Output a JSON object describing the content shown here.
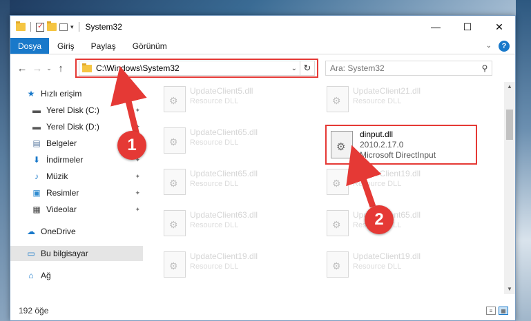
{
  "window": {
    "title": "System32",
    "minimize_glyph": "—",
    "maximize_glyph": "☐",
    "close_glyph": "✕"
  },
  "qat": {
    "dropdown_glyph": "▾"
  },
  "ribbon": {
    "tabs": [
      "Dosya",
      "Giriş",
      "Paylaş",
      "Görünüm"
    ],
    "expand_glyph": "⌄",
    "help_glyph": "?"
  },
  "nav": {
    "back_glyph": "←",
    "forward_glyph": "→",
    "recent_glyph": "⌄",
    "up_glyph": "↑",
    "address": "C:\\Windows\\System32",
    "address_dropdown_glyph": "⌄",
    "refresh_glyph": "↻",
    "search_placeholder": "Ara: System32",
    "search_glyph": "⚲"
  },
  "sidebar": {
    "items": [
      {
        "label": "Hızlı erişim",
        "icon": "star-icon",
        "glyph": "★",
        "color": "#1979ca",
        "pinned": false
      },
      {
        "label": "Yerel Disk (C:)",
        "icon": "drive-icon",
        "glyph": "▬",
        "color": "#555",
        "pinned": true
      },
      {
        "label": "Yerel Disk (D:)",
        "icon": "drive-icon",
        "glyph": "▬",
        "color": "#555",
        "pinned": true
      },
      {
        "label": "Belgeler",
        "icon": "documents-icon",
        "glyph": "▤",
        "color": "#5a7aa0",
        "pinned": true
      },
      {
        "label": "İndirmeler",
        "icon": "download-icon",
        "glyph": "⬇",
        "color": "#1979ca",
        "pinned": true
      },
      {
        "label": "Müzik",
        "icon": "music-icon",
        "glyph": "♪",
        "color": "#1979ca",
        "pinned": true
      },
      {
        "label": "Resimler",
        "icon": "pictures-icon",
        "glyph": "▣",
        "color": "#2e8bd0",
        "pinned": true
      },
      {
        "label": "Videolar",
        "icon": "video-icon",
        "glyph": "▦",
        "color": "#444",
        "pinned": true
      },
      {
        "label": "OneDrive",
        "icon": "cloud-icon",
        "glyph": "☁",
        "color": "#1979ca",
        "pinned": false
      },
      {
        "label": "Bu bilgisayar",
        "icon": "computer-icon",
        "glyph": "▭",
        "color": "#1979ca",
        "pinned": false,
        "selected": true
      },
      {
        "label": "Ağ",
        "icon": "network-icon",
        "glyph": "⌂",
        "color": "#1979ca",
        "pinned": false
      }
    ],
    "pin_glyph": "📌"
  },
  "files": {
    "col1": [
      {
        "name": "UpdateClient5.dll",
        "desc": "Resource DLL"
      },
      {
        "name": "UpdateClient65.dll",
        "desc": "Resource DLL"
      },
      {
        "name": "UpdateClient65.dll",
        "desc": "Resource DLL"
      },
      {
        "name": "UpdateClient63.dll",
        "desc": "Resource DLL"
      },
      {
        "name": "UpdateClient19.dll",
        "desc": "Resource DLL"
      }
    ],
    "col2": [
      {
        "name": "UpdateClient21.dll",
        "desc": "Resource DLL"
      },
      {
        "name": "UpdateClient19.dll",
        "desc": "Resource DLL"
      },
      {
        "name": "UpdateClient65.dll",
        "desc": "Resource DLL"
      },
      {
        "name": "UpdateClient19.dll",
        "desc": "Resource DLL"
      }
    ],
    "highlight": {
      "name": "dinput.dll",
      "version": "2010.2.17.0",
      "desc": "Microsoft DirectInput"
    }
  },
  "status": {
    "count": "192 öğe"
  },
  "scroll": {
    "up_glyph": "▲",
    "down_glyph": "▼"
  },
  "annotations": {
    "step1": "1",
    "step2": "2",
    "color": "#e53935"
  }
}
